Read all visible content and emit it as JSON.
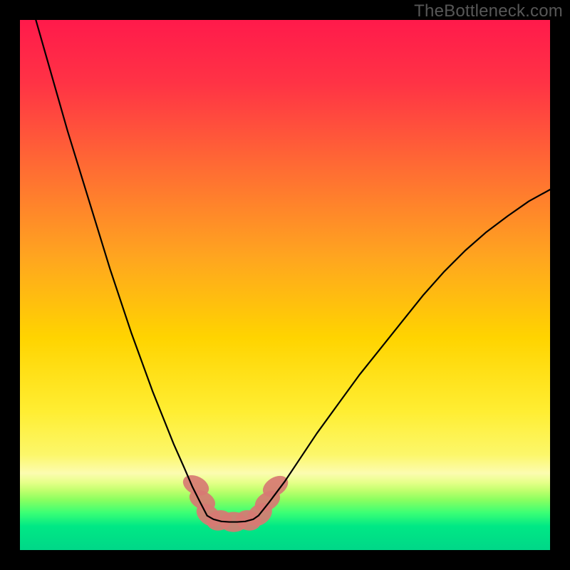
{
  "watermark": "TheBottleneck.com",
  "chart_data": {
    "type": "line",
    "title": "",
    "xlabel": "",
    "ylabel": "",
    "xlim": [
      0,
      100
    ],
    "ylim": [
      0,
      100
    ],
    "grid": false,
    "legend": false,
    "background_gradient": {
      "stops": [
        {
          "pos": 0.0,
          "color": "#ff1a4b"
        },
        {
          "pos": 0.12,
          "color": "#ff3345"
        },
        {
          "pos": 0.28,
          "color": "#ff6c33"
        },
        {
          "pos": 0.45,
          "color": "#ffa61f"
        },
        {
          "pos": 0.6,
          "color": "#ffd400"
        },
        {
          "pos": 0.74,
          "color": "#ffee33"
        },
        {
          "pos": 0.82,
          "color": "#fcf76a"
        },
        {
          "pos": 0.855,
          "color": "#fcfcb0"
        },
        {
          "pos": 0.872,
          "color": "#e7ff8a"
        },
        {
          "pos": 0.888,
          "color": "#c0ff6d"
        },
        {
          "pos": 0.905,
          "color": "#8bff60"
        },
        {
          "pos": 0.93,
          "color": "#3aff75"
        },
        {
          "pos": 0.955,
          "color": "#00e885"
        },
        {
          "pos": 1.0,
          "color": "#00d788"
        }
      ]
    },
    "series": [
      {
        "name": "left-arm",
        "stroke": "#000000",
        "stroke_width": 2.2,
        "x": [
          3,
          5,
          7,
          9,
          11,
          13,
          15,
          17,
          19,
          21,
          23,
          25,
          27,
          29,
          31,
          32.5,
          34,
          35.3
        ],
        "y": [
          100,
          93,
          86,
          79,
          72.5,
          66,
          59.5,
          53,
          47,
          41,
          35.5,
          30,
          25,
          20,
          15.5,
          12,
          9,
          6.5
        ]
      },
      {
        "name": "flat-bottom",
        "stroke": "#000000",
        "stroke_width": 2.2,
        "x": [
          35.3,
          36.5,
          38,
          39.5,
          41,
          42.5,
          44,
          45
        ],
        "y": [
          6.5,
          5.8,
          5.4,
          5.3,
          5.3,
          5.4,
          5.8,
          6.5
        ]
      },
      {
        "name": "right-arm",
        "stroke": "#000000",
        "stroke_width": 2.2,
        "x": [
          45,
          47,
          50,
          53,
          56,
          60,
          64,
          68,
          72,
          76,
          80,
          84,
          88,
          92,
          96,
          100
        ],
        "y": [
          6.5,
          9,
          13,
          17.5,
          22,
          27.5,
          33,
          38,
          43,
          48,
          52.5,
          56.5,
          60,
          63,
          65.8,
          68
        ]
      }
    ],
    "markers": {
      "name": "bottom-blobs",
      "fill": "#d77a73",
      "fill_opacity": 0.92,
      "points": [
        {
          "x": 33.2,
          "y": 12.2,
          "rx": 1.7,
          "ry": 2.6,
          "rot": -63
        },
        {
          "x": 34.4,
          "y": 9.4,
          "rx": 1.7,
          "ry": 2.6,
          "rot": -63
        },
        {
          "x": 35.6,
          "y": 6.6,
          "rx": 1.8,
          "ry": 2.6,
          "rot": -50
        },
        {
          "x": 37.6,
          "y": 5.6,
          "rx": 2.4,
          "ry": 1.9,
          "rot": -12
        },
        {
          "x": 40.3,
          "y": 5.3,
          "rx": 2.6,
          "ry": 1.9,
          "rot": 0
        },
        {
          "x": 43.1,
          "y": 5.6,
          "rx": 2.4,
          "ry": 1.9,
          "rot": 12
        },
        {
          "x": 45.2,
          "y": 6.7,
          "rx": 1.9,
          "ry": 2.6,
          "rot": 52
        },
        {
          "x": 46.7,
          "y": 9.2,
          "rx": 1.7,
          "ry": 2.6,
          "rot": 58
        },
        {
          "x": 48.2,
          "y": 12.0,
          "rx": 1.7,
          "ry": 2.6,
          "rot": 58
        }
      ]
    }
  }
}
